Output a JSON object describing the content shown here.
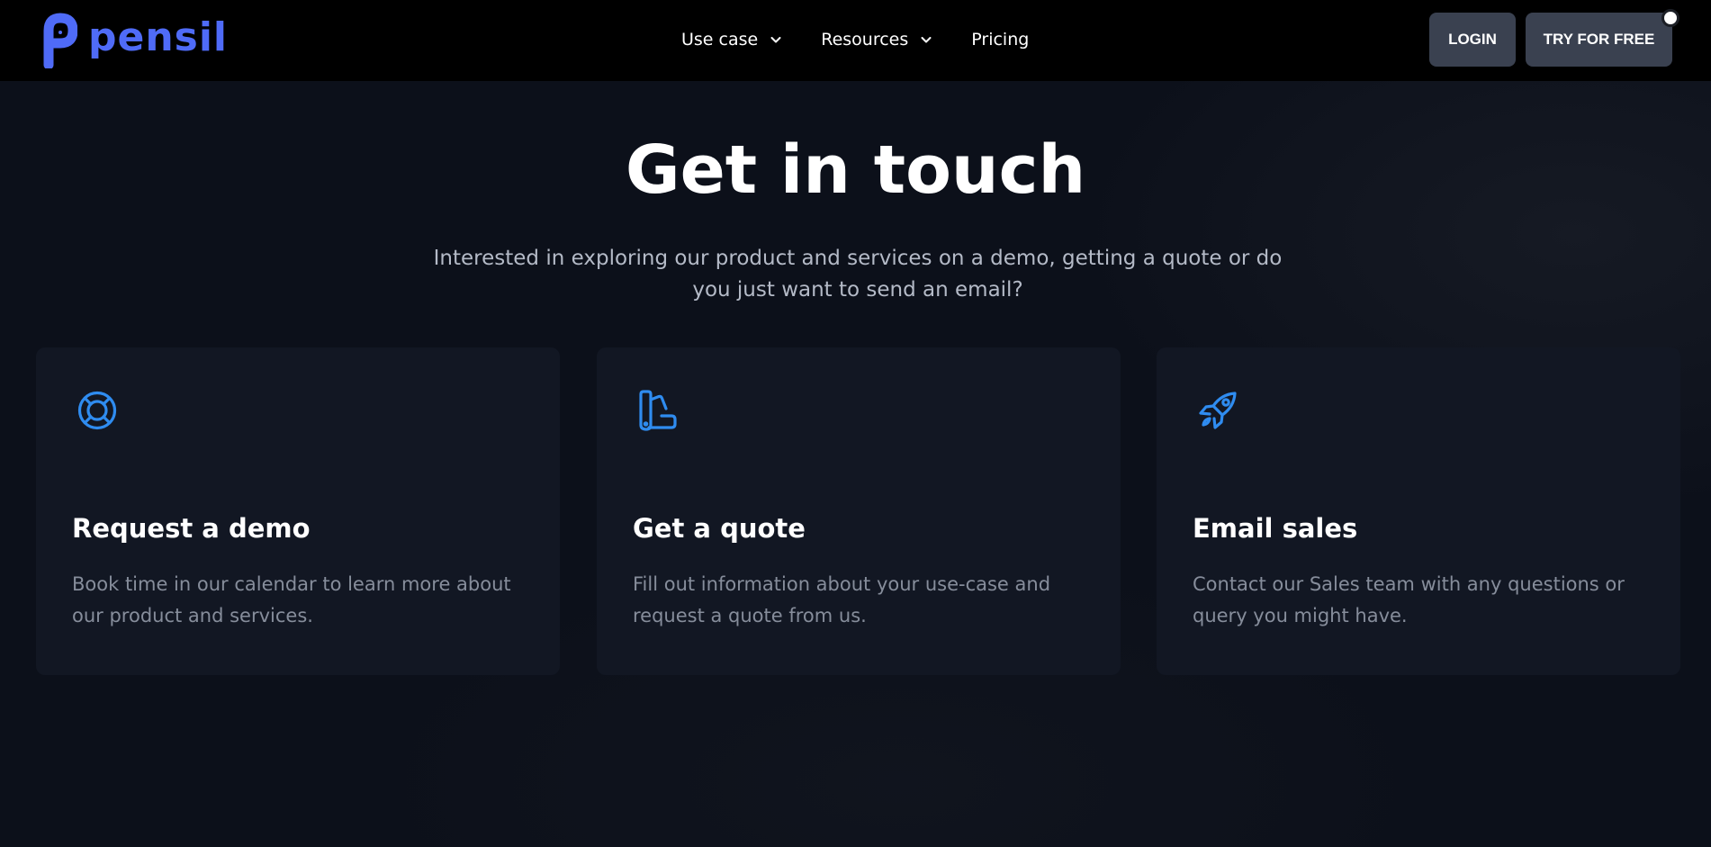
{
  "brand": {
    "name": "pensil",
    "color": "#4f6bf7"
  },
  "nav": {
    "items": [
      {
        "label": "Use case",
        "has_dropdown": true
      },
      {
        "label": "Resources",
        "has_dropdown": true
      },
      {
        "label": "Pricing",
        "has_dropdown": false
      }
    ],
    "login_label": "LOGIN",
    "try_label": "TRY FOR FREE"
  },
  "hero": {
    "title": "Get in touch",
    "subtitle": "Interested in exploring our product and services on a demo, getting a quote or do you just want to send an email?"
  },
  "cards": [
    {
      "icon": "lifebuoy-icon",
      "title": "Request a demo",
      "description": "Book time in our calendar to learn more about our product and services."
    },
    {
      "icon": "swatch-icon",
      "title": "Get a quote",
      "description": "Fill out information about your use-case and request a quote from us."
    },
    {
      "icon": "rocket-icon",
      "title": "Email sales",
      "description": "Contact our Sales team with any questions or query you might have."
    }
  ],
  "colors": {
    "accent_icon": "#2f8cf0",
    "button_bg": "#3a4150",
    "card_bg": "#121723",
    "page_bg": "#0c101a"
  }
}
